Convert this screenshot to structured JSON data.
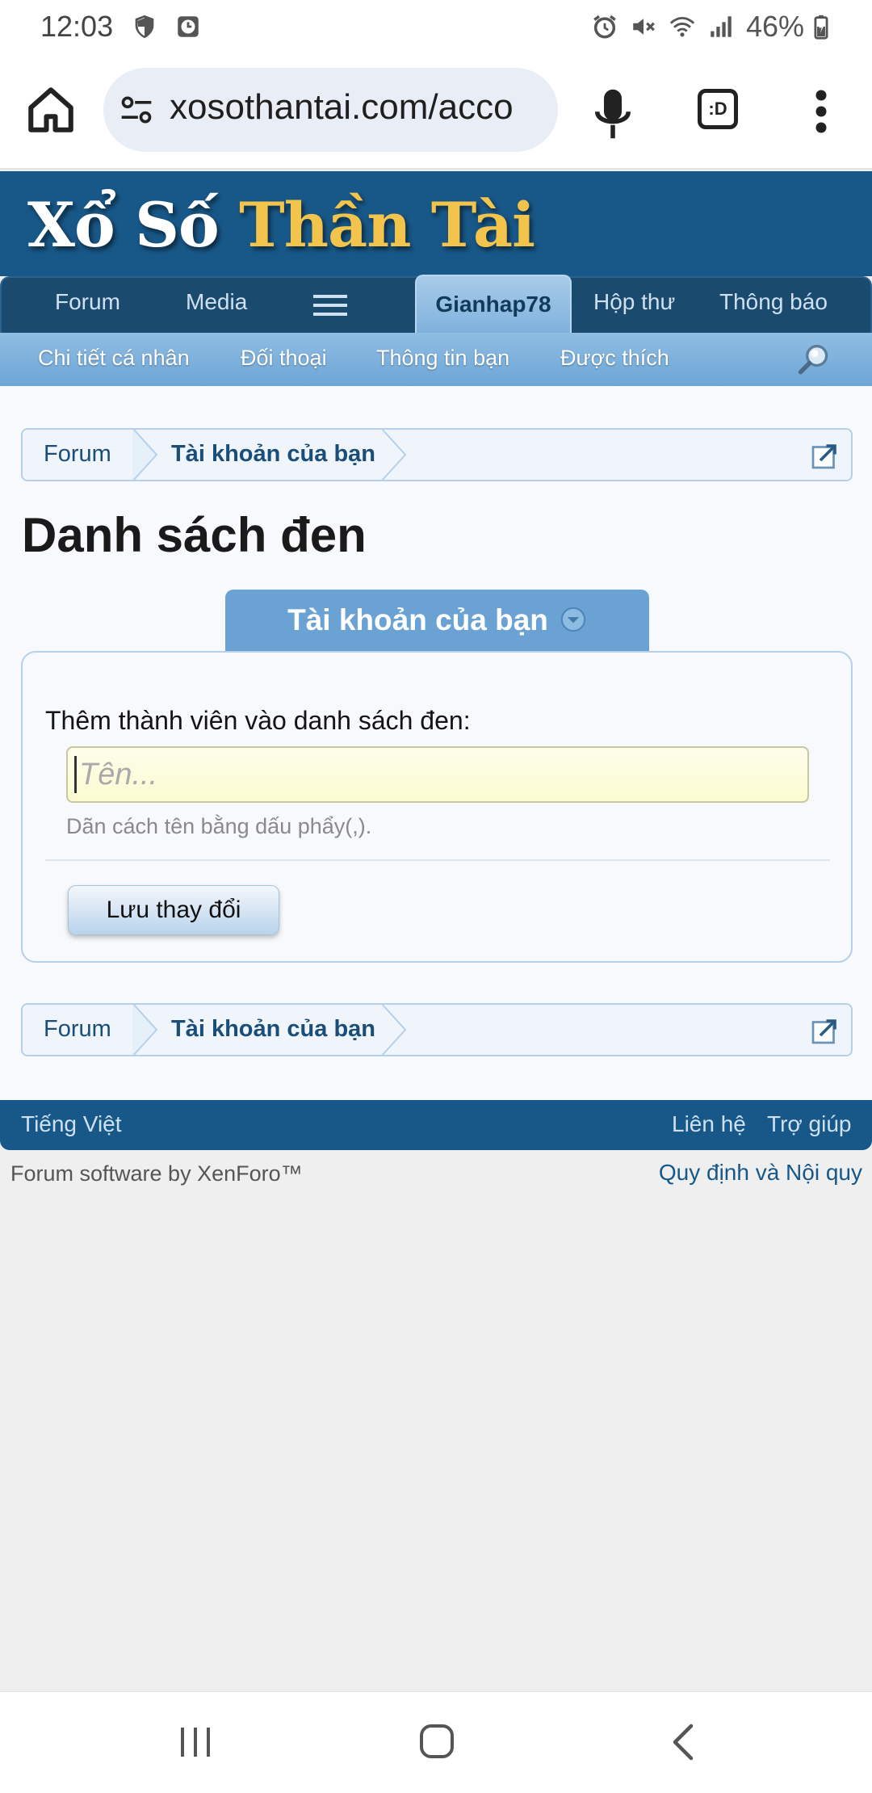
{
  "status_bar": {
    "time": "12:03",
    "battery": "46%",
    "icons": [
      "shield-icon",
      "clock-app-icon",
      "alarm-icon",
      "mute-icon",
      "wifi-icon",
      "signal-icon",
      "battery-icon"
    ]
  },
  "browser": {
    "url": "xosothantai.com/acco",
    "tab_label": ":D",
    "icons": [
      "home-icon",
      "site-settings-icon",
      "mic-icon",
      "tab-switcher-icon",
      "more-vert-icon"
    ]
  },
  "site": {
    "logo_part1": "Xổ Số ",
    "logo_part2": "Thần Tài",
    "logo_colors": {
      "white": "#ffffff",
      "gold": "#f3c44c"
    },
    "header_color": "#185888"
  },
  "nav": {
    "forum": "Forum",
    "media": "Media",
    "user": "Gianhap78",
    "inbox": "Hộp thư",
    "alerts": "Thông báo"
  },
  "subnav": {
    "profile": "Chi tiết cá nhân",
    "conversations": "Đối thoại",
    "news_feed": "Thông tin bạn",
    "likes": "Được thích"
  },
  "breadcrumb": {
    "home": "Forum",
    "account": "Tài khoản của bạn"
  },
  "page": {
    "title": "Danh sách đen",
    "tab_label": "Tài khoản của bạn"
  },
  "form": {
    "label": "Thêm thành viên vào danh sách đen:",
    "placeholder": "Tên...",
    "value": "",
    "hint": "Dãn cách tên bằng dấu phẩy(,).",
    "save_label": "Lưu thay đổi"
  },
  "footer": {
    "language": "Tiếng Việt",
    "contact": "Liên hệ",
    "help": "Trợ giúp",
    "copyright": "Forum software by XenForo™",
    "rules": "Quy định và Nội quy"
  }
}
